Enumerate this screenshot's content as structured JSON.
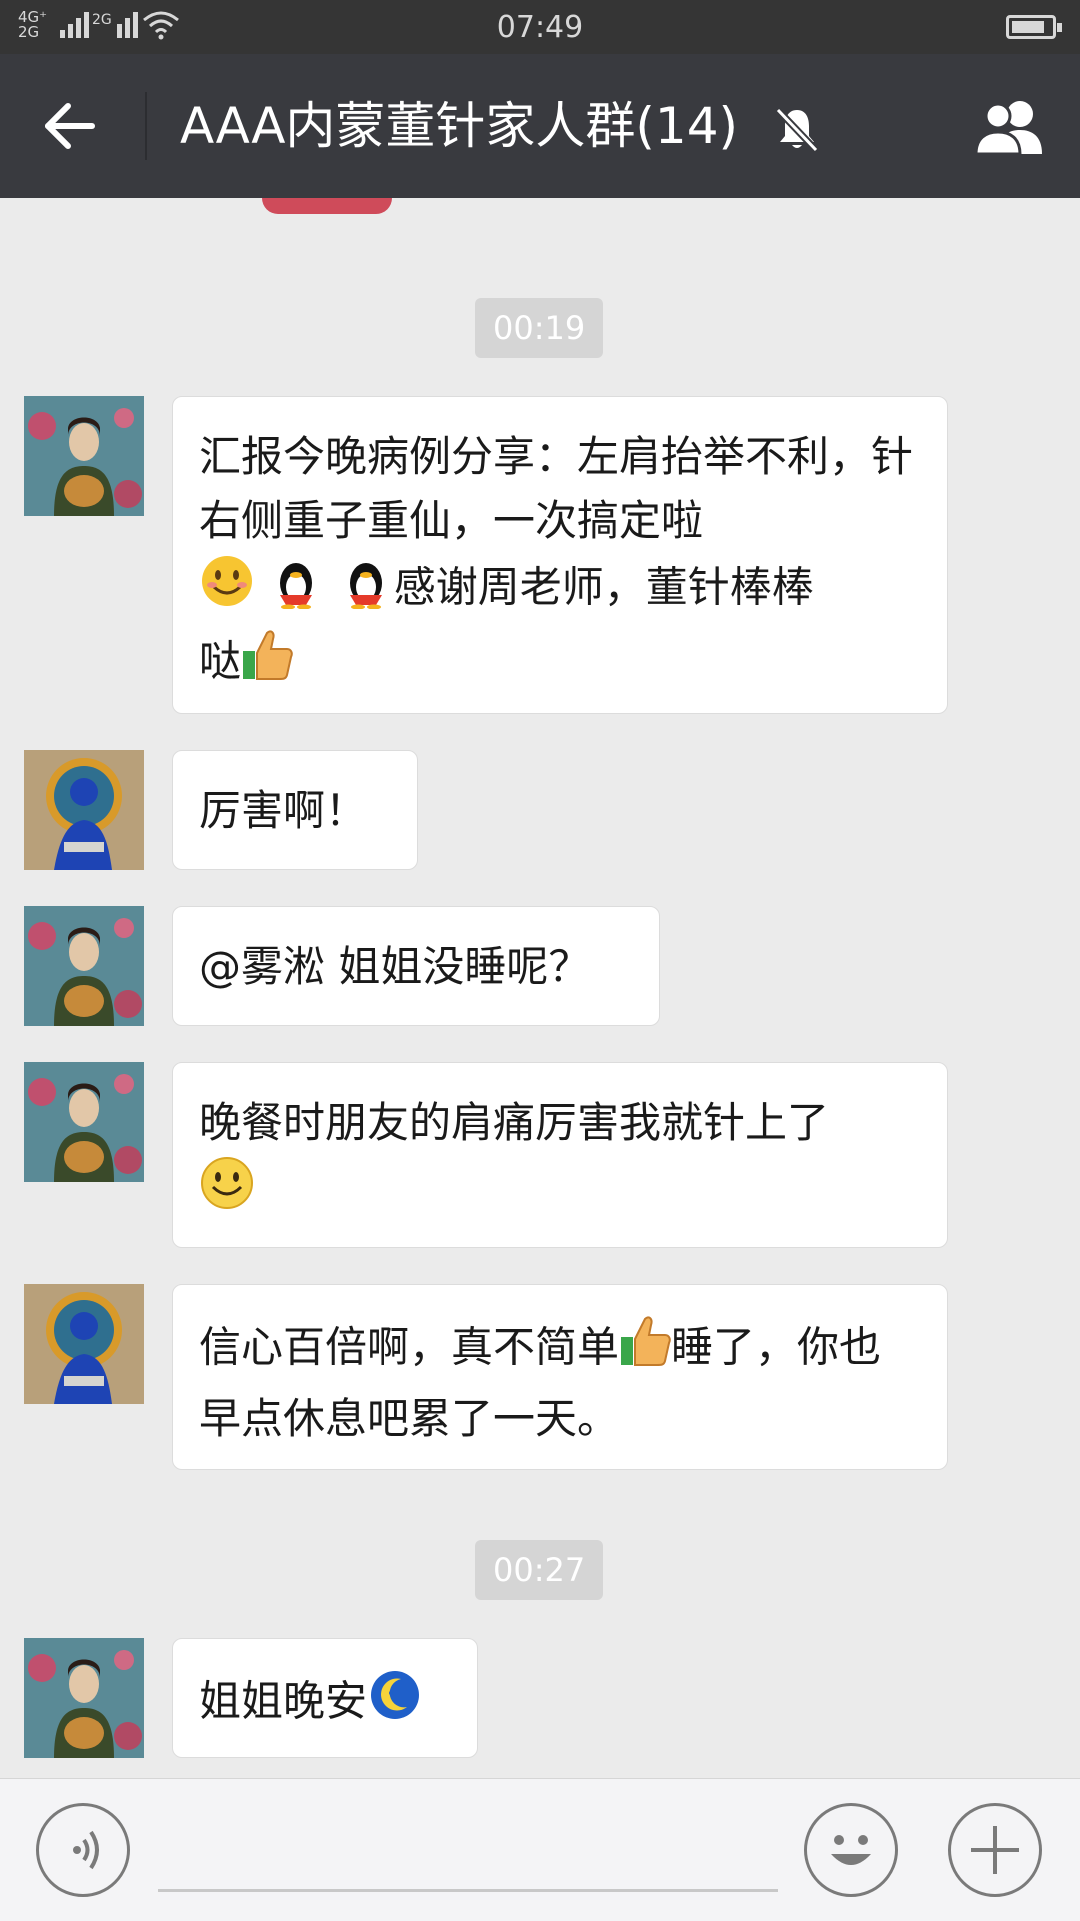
{
  "status_bar": {
    "network_top": "4G⁺",
    "network_bottom": "2G",
    "network2": "2G",
    "time": "07:49"
  },
  "header": {
    "title": "AAA内蒙董针家人群(14)",
    "icons": [
      "back-arrow-icon",
      "mute-bell-icon",
      "group-members-icon"
    ]
  },
  "chat": {
    "timestamps": [
      "00:19",
      "00:27"
    ],
    "messages": [
      {
        "avatar": "avatar-woman-portrait",
        "text": "汇报今晚病例分享：左肩抬举不利，针右侧重子重仙，一次搞定啦",
        "text2": "感谢周老师，董针棒棒",
        "text3": "哒",
        "emojis": [
          "smile-emoji",
          "penguin-emoji",
          "penguin-emoji",
          "thumbs-up-emoji"
        ]
      },
      {
        "avatar": "avatar-blue-deity",
        "text": "厉害啊！"
      },
      {
        "avatar": "avatar-woman-portrait",
        "text": "@雾淞 姐姐没睡呢？"
      },
      {
        "avatar": "avatar-woman-portrait",
        "text": "晚餐时朋友的肩痛厉害我就针上了",
        "emojis": [
          "grin-emoji"
        ]
      },
      {
        "avatar": "avatar-blue-deity",
        "text": "信心百倍啊，真不简单",
        "text2": "睡了，你也早点休息吧累了一天。",
        "emojis": [
          "thumbs-up-emoji"
        ]
      },
      {
        "avatar": "avatar-woman-portrait",
        "text": "姐姐晚安",
        "emojis": [
          "moon-emoji"
        ]
      }
    ]
  },
  "input_bar": {
    "icons": [
      "voice-icon",
      "emoji-face-icon",
      "plus-icon"
    ]
  },
  "colors": {
    "header_bg": "#393a3f",
    "status_bg": "#353535",
    "chat_bg": "#ebebeb",
    "bubble_bg": "#ffffff"
  }
}
